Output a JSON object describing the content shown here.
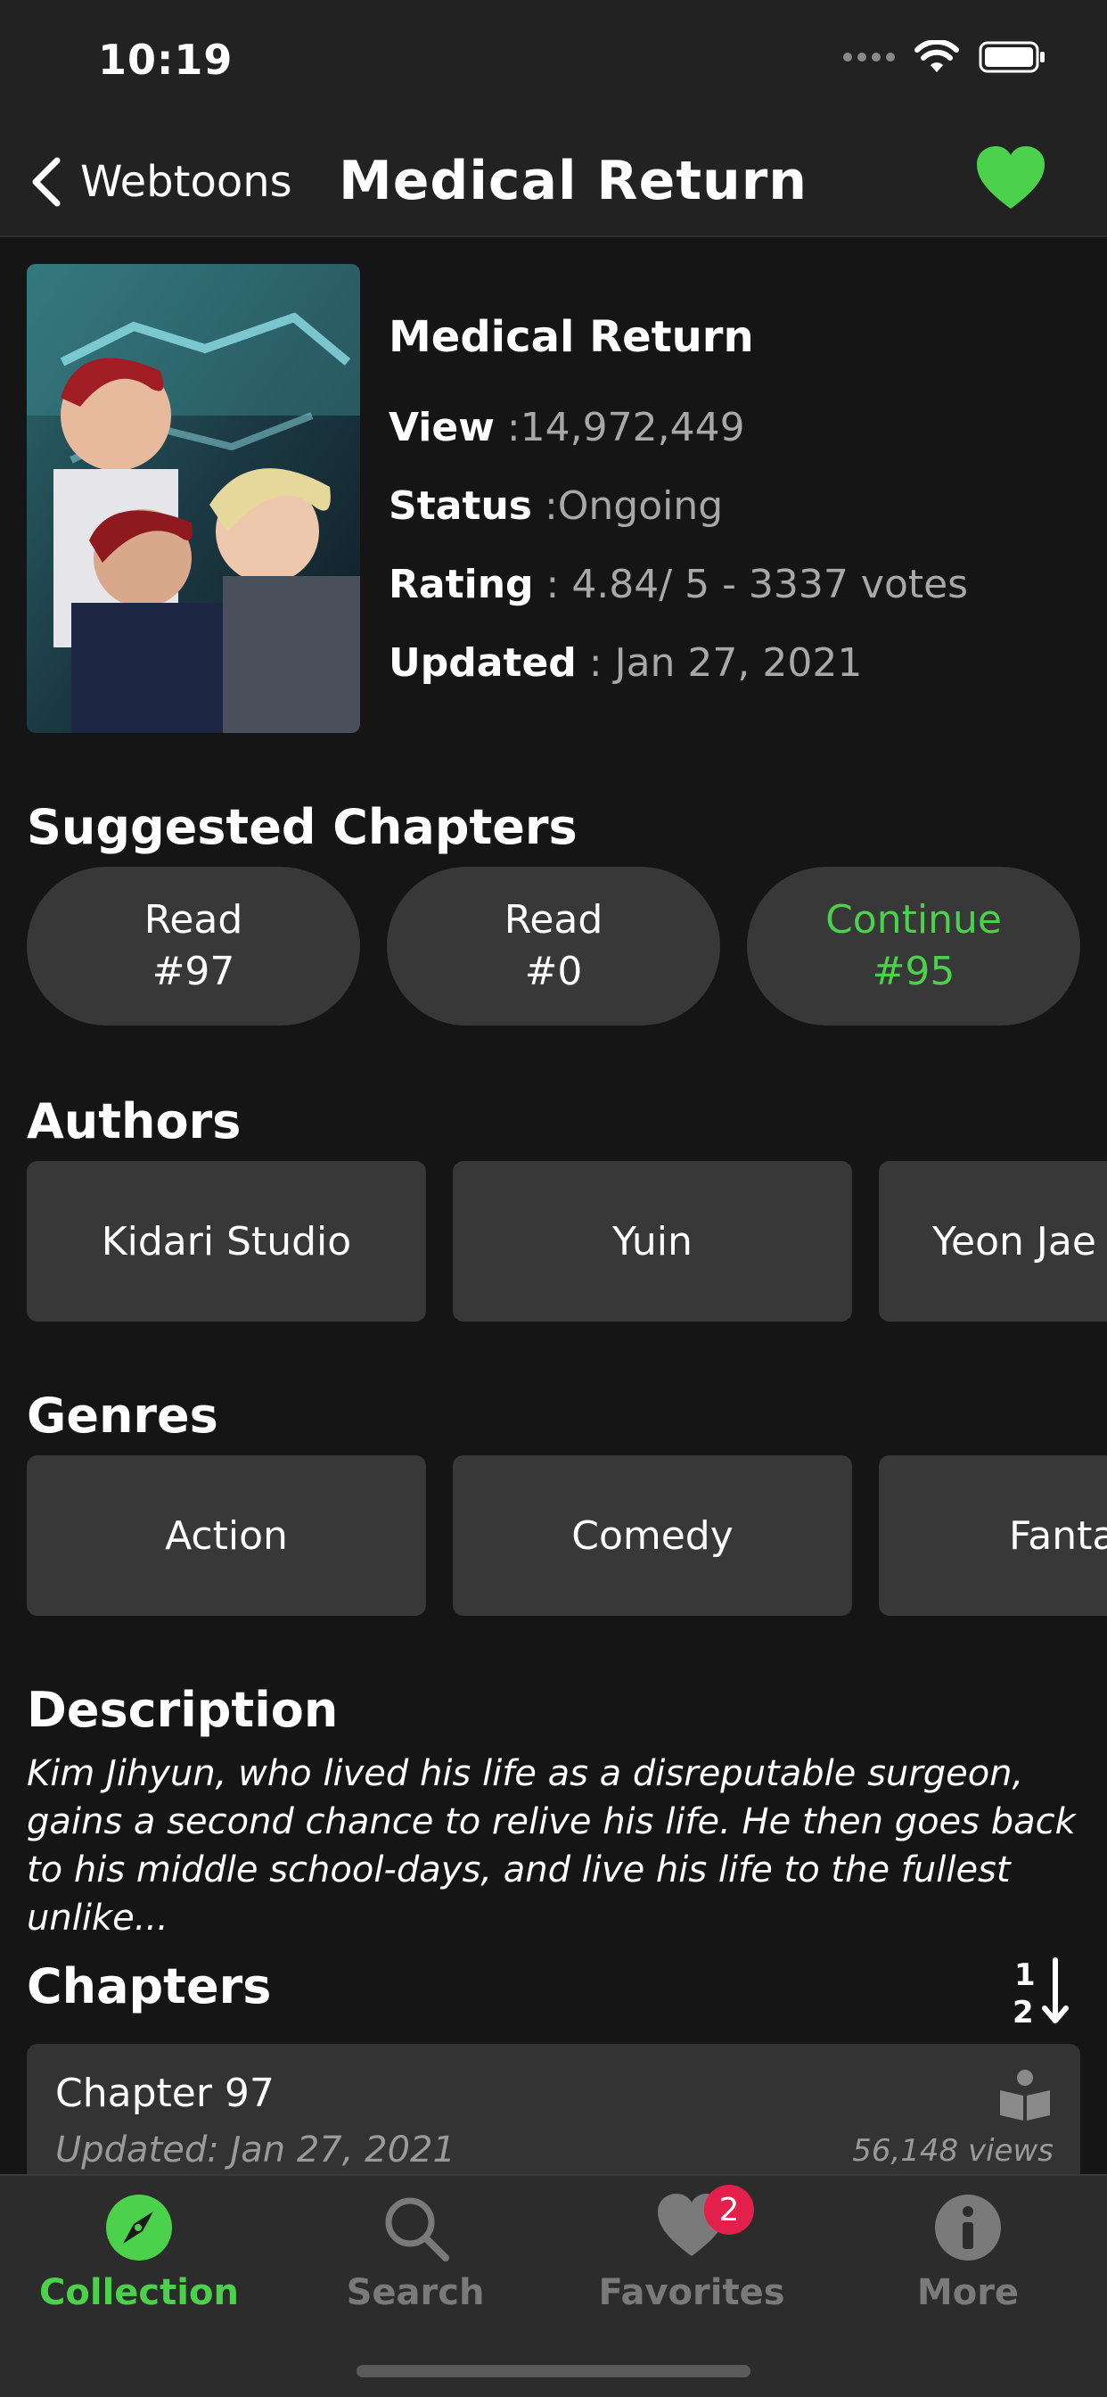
{
  "status_bar": {
    "time": "10:19"
  },
  "nav": {
    "back_label": "Webtoons",
    "title": "Medical Return",
    "favorite_color": "#4cd14c"
  },
  "info": {
    "title": "Medical Return",
    "view_label": "View",
    "view_value": " :14,972,449",
    "status_label": "Status",
    "status_value": " :Ongoing",
    "rating_label": "Rating",
    "rating_value": " : 4.84/ 5  - 3337 votes",
    "updated_label": "Updated",
    "updated_value": " : Jan 27, 2021"
  },
  "suggested": {
    "title": "Suggested Chapters",
    "items": [
      {
        "line1": "Read",
        "line2": "#97"
      },
      {
        "line1": "Read",
        "line2": "#0"
      },
      {
        "line1": "Continue",
        "line2": "#95"
      }
    ]
  },
  "authors": {
    "title": "Authors",
    "items": [
      "Kidari Studio",
      "Yuin",
      "Yeon Jae"
    ]
  },
  "genres": {
    "title": "Genres",
    "items": [
      "Action",
      "Comedy",
      "Fanta"
    ]
  },
  "description": {
    "title": "Description",
    "text": "Kim Jihyun, who lived his life as a disreputable surgeon, gains a second chance to relive his life. He then goes back to his middle school-days, and live his life to the fullest unlike..."
  },
  "chapters": {
    "title": "Chapters",
    "sort_label_1": "1",
    "sort_label_2": "2",
    "rows": [
      {
        "title": "Chapter 97",
        "updated": "Updated: Jan 27, 2021",
        "views": "56,148 views"
      }
    ]
  },
  "tabs": [
    {
      "label": "Collection",
      "icon": "compass-icon",
      "active": true
    },
    {
      "label": "Search",
      "icon": "search-icon"
    },
    {
      "label": "Favorites",
      "icon": "heart-icon",
      "badge": "2"
    },
    {
      "label": "More",
      "icon": "info-icon"
    }
  ],
  "colors": {
    "accent": "#4cd14c",
    "badge": "#e3204b",
    "background": "#151515",
    "card": "#383838"
  }
}
